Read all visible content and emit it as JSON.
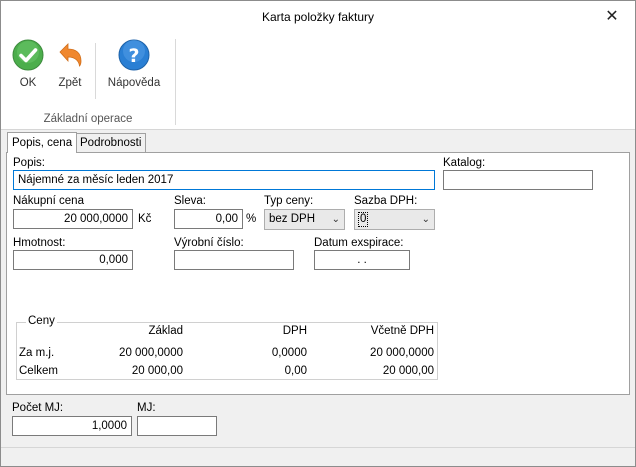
{
  "window": {
    "title": "Karta položky faktury",
    "close": "✕"
  },
  "ribbon": {
    "ok_label": "OK",
    "back_label": "Zpět",
    "help_label": "Nápověda",
    "group_label": "Základní operace"
  },
  "tabs": [
    {
      "label": "Popis, cena",
      "active": true
    },
    {
      "label": "Podrobnosti",
      "active": false
    }
  ],
  "form": {
    "popis_label": "Popis:",
    "popis_value": "Nájemné za měsíc  leden 2017",
    "katalog_label": "Katalog:",
    "katalog_value": "",
    "nakupni_label": "Nákupní cena",
    "nakupni_value": "20 000,0000",
    "nakupni_unit": "Kč",
    "sleva_label": "Sleva:",
    "sleva_value": "0,00",
    "sleva_unit": "%",
    "typ_label": "Typ ceny:",
    "typ_value": "bez DPH",
    "sazba_label": "Sazba DPH:",
    "sazba_value": "0",
    "hmotnost_label": "Hmotnost:",
    "hmotnost_value": "0,000",
    "vyrobni_label": "Výrobní číslo:",
    "vyrobni_value": "",
    "datum_label": "Datum exspirace:",
    "datum_value": ".     ."
  },
  "ceny": {
    "legend": "Ceny",
    "headers": [
      "Základ",
      "DPH",
      "Včetně DPH"
    ],
    "rows": [
      {
        "label": "Za m.j.",
        "zaklad": "20 000,0000",
        "dph": "0,0000",
        "vcetne": "20 000,0000"
      },
      {
        "label": "Celkem",
        "zaklad": "20 000,00",
        "dph": "0,00",
        "vcetne": "20 000,00"
      }
    ]
  },
  "bottom": {
    "pocet_label": "Počet MJ:",
    "pocet_value": "1,0000",
    "mj_label": "MJ:",
    "mj_value": ""
  },
  "colors": {
    "ok_green": "#5cb85c",
    "back_orange": "#f0882f",
    "help_blue": "#2a7fd4"
  }
}
